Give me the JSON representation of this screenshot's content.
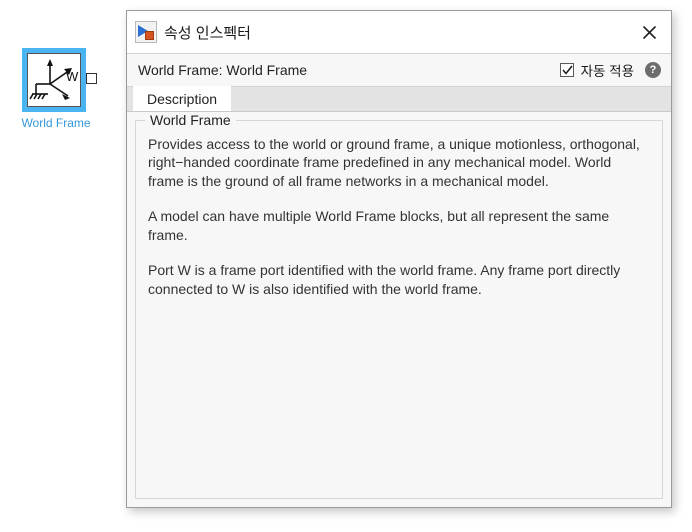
{
  "canvas": {
    "block": {
      "name": "World Frame",
      "port_label": "W",
      "icon": "world-frame-coordinate-axes",
      "selected": true,
      "selection_color": "#4ab4f0",
      "label_color": "#3399dd"
    }
  },
  "dialog": {
    "titlebar": {
      "icon": "property-inspector-icon",
      "title": "속성 인스펙터",
      "close_label": "✕"
    },
    "subheader": {
      "title": "World Frame: World Frame",
      "auto_apply_label": "자동 적용",
      "auto_apply_checked": true,
      "help_label": "?"
    },
    "tabs": [
      {
        "label": "Description",
        "active": true
      }
    ],
    "group": {
      "legend": "World Frame",
      "paragraphs": [
        "Provides access to the world or ground frame, a unique motionless, orthogonal, right−handed coordinate frame predefined in any mechanical model. World frame is the ground of all frame networks in a mechanical model.",
        "A model can have multiple World Frame blocks, but all represent the same frame.",
        "Port W is a frame port identified with the world frame. Any frame port directly connected to W is also identified with the world frame."
      ]
    }
  }
}
